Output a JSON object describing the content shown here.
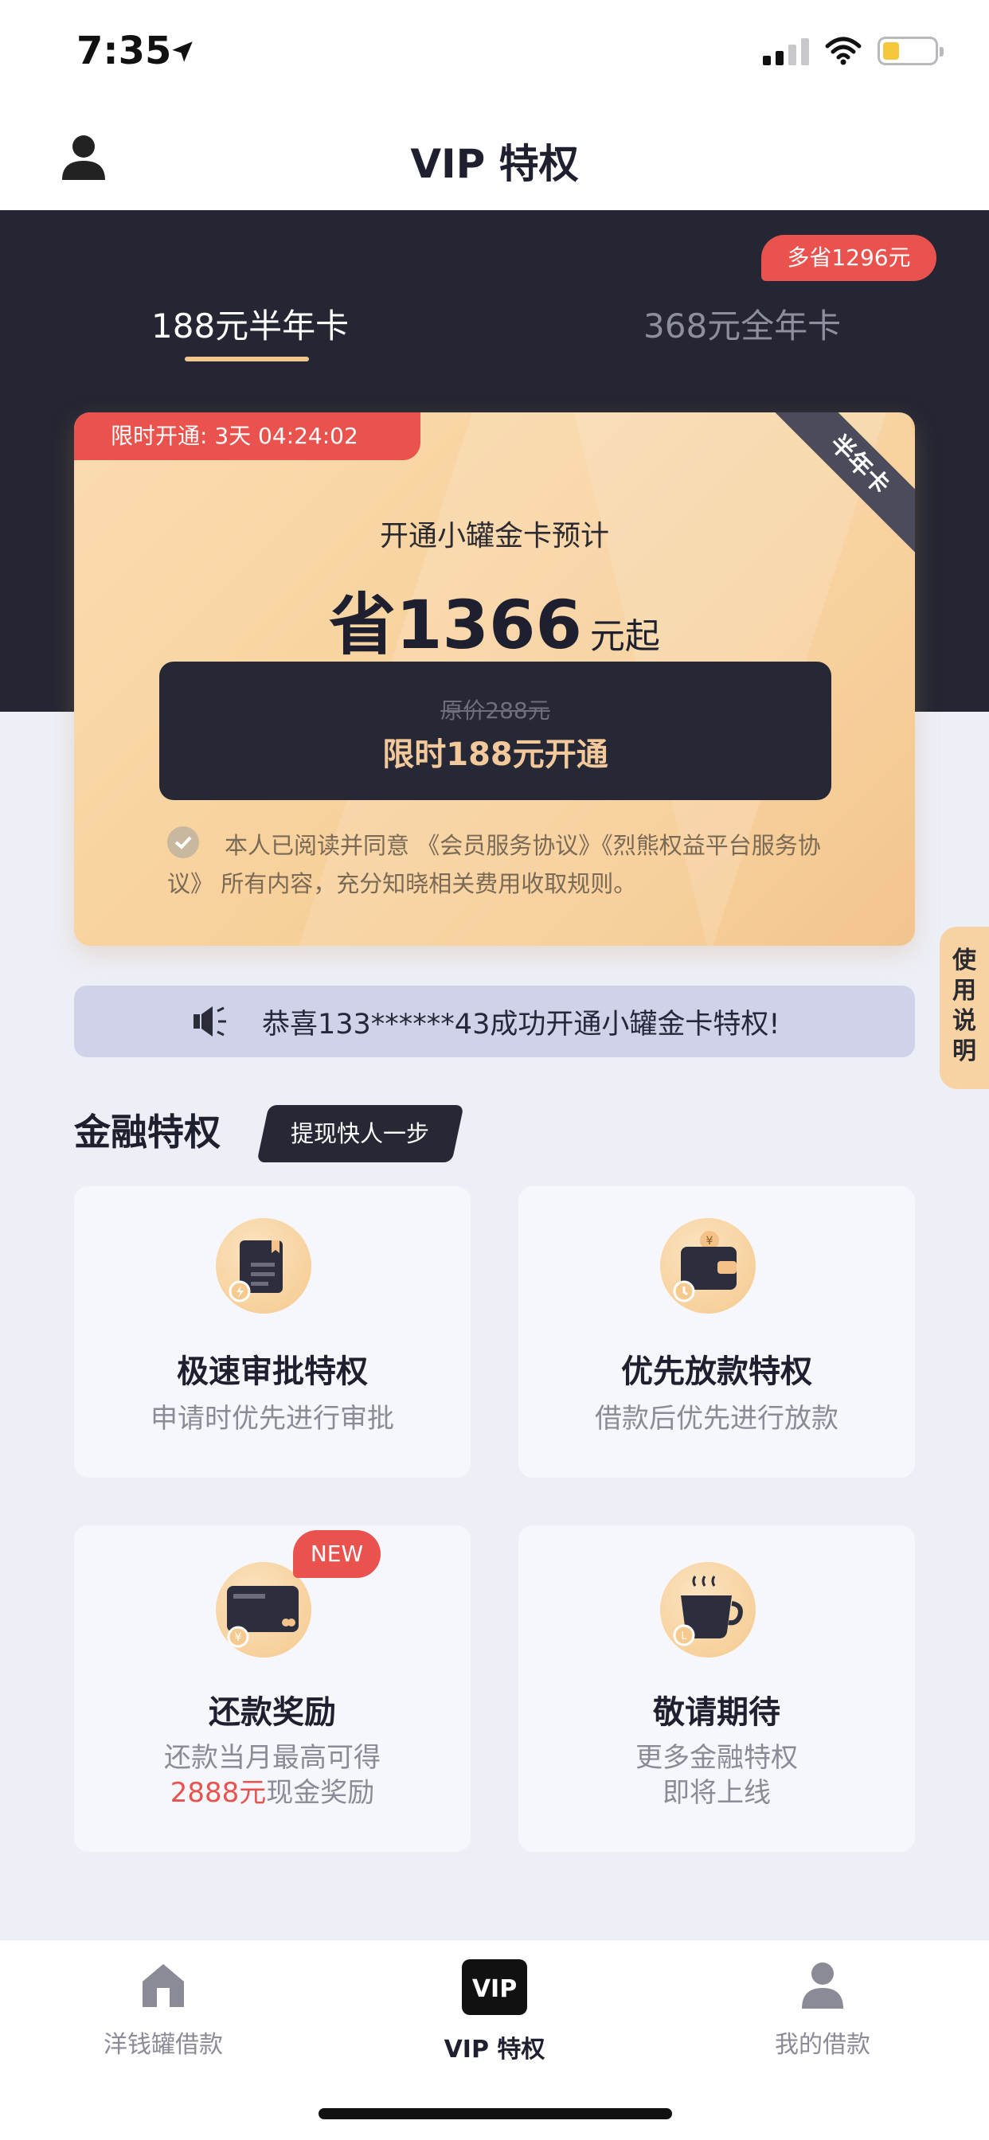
{
  "status_bar": {
    "time": "7:35"
  },
  "nav": {
    "title": "VIP 特权"
  },
  "plans": {
    "save_tag": "多省1296元",
    "tabs": [
      {
        "label": "188元半年卡",
        "active": true
      },
      {
        "label": "368元全年卡",
        "active": false
      }
    ]
  },
  "card": {
    "promo": "限时开通:   3天 04:24:02",
    "ribbon": "半年卡",
    "subtitle": "开通小罐金卡预计",
    "save_prefix": "省",
    "save_amount": "1366",
    "save_suffix": "元起",
    "original_price": "原价288元",
    "cta": "限时188元开通",
    "agreement": "本人已阅读并同意 《会员服务协议》《烈熊权益平台服务协议》 所有内容，充分知晓相关费用收取规则。"
  },
  "side_tab": {
    "label": "使用说明"
  },
  "marquee": {
    "text": "恭喜133******43成功开通小罐金卡特权!"
  },
  "section": {
    "title": "金融特权",
    "badge": "提现快人一步"
  },
  "privileges": [
    {
      "title": "极速审批特权",
      "desc": "申请时优先进行审批",
      "icon": "approval-doc-icon"
    },
    {
      "title": "优先放款特权",
      "desc": "借款后优先进行放款",
      "icon": "wallet-icon"
    },
    {
      "title": "还款奖励",
      "desc_line1": "还款当月最高可得",
      "desc_highlight": "2888元",
      "desc_rest": "现金奖励",
      "new_badge": "NEW",
      "icon": "card-icon"
    },
    {
      "title": "敬请期待",
      "desc_line1": "更多金融特权",
      "desc_line2": "即将上线",
      "icon": "coffee-cup-icon"
    }
  ],
  "tabbar": [
    {
      "label": "洋钱罐借款",
      "icon": "home-icon",
      "active": false
    },
    {
      "label": "VIP 特权",
      "icon": "vip-icon",
      "active": true
    },
    {
      "label": "我的借款",
      "icon": "person-icon",
      "active": false
    }
  ],
  "colors": {
    "accent_red": "#E9524D",
    "dark": "#242633",
    "gold": "#F6C98E"
  }
}
